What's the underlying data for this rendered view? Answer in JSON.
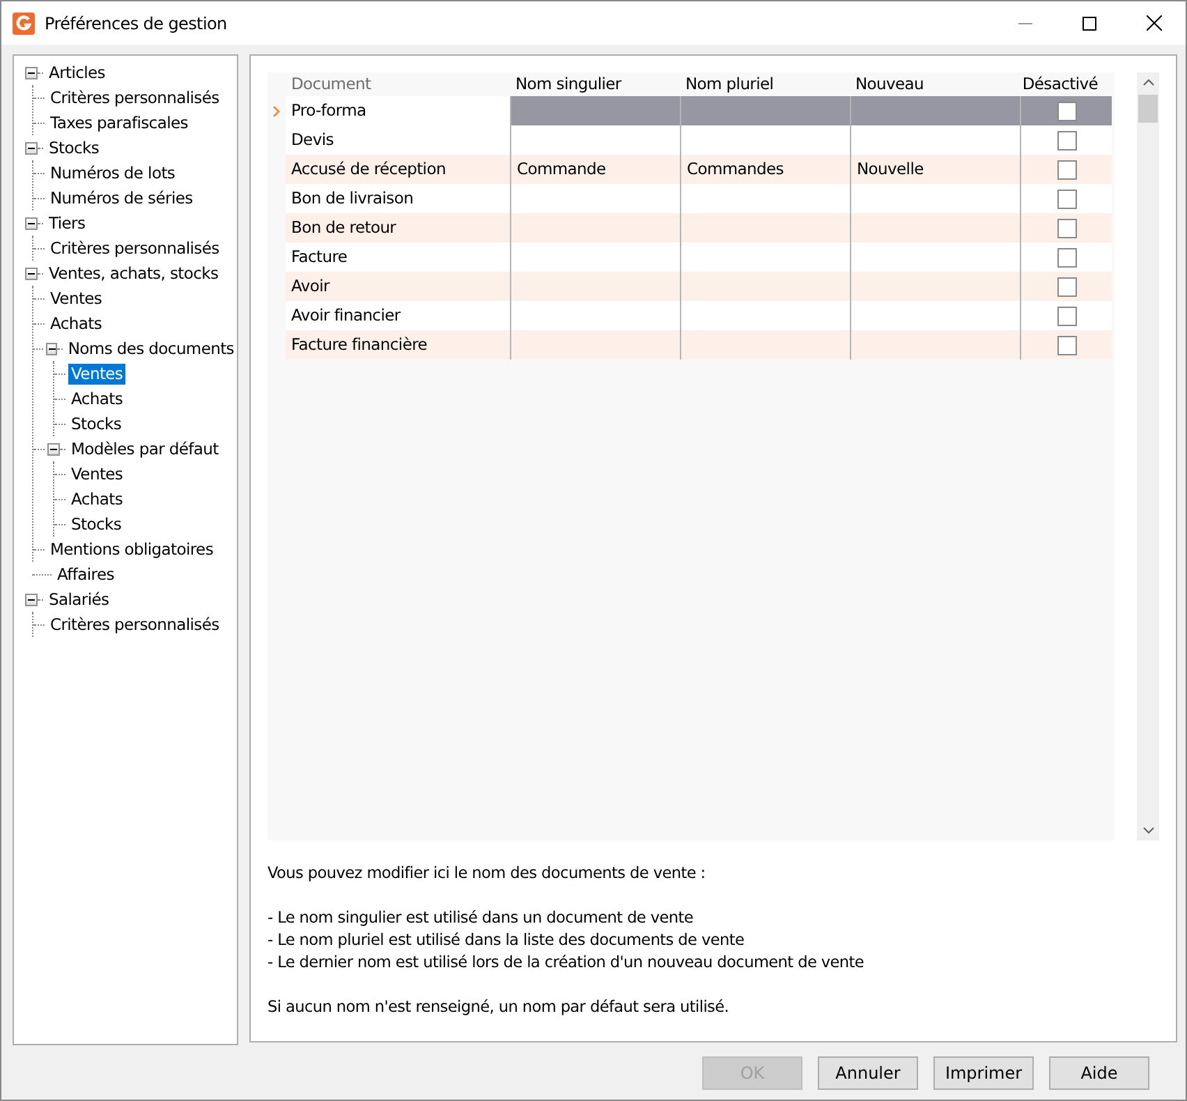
{
  "window": {
    "title": "Préférences de gestion"
  },
  "tree": [
    {
      "label": "Articles",
      "expanded": true,
      "selected": false,
      "children": [
        {
          "label": "Critères personnalisés",
          "selected": false
        },
        {
          "label": "Taxes parafiscales",
          "selected": false
        }
      ]
    },
    {
      "label": "Stocks",
      "expanded": true,
      "selected": false,
      "children": [
        {
          "label": "Numéros de lots",
          "selected": false
        },
        {
          "label": "Numéros de séries",
          "selected": false
        }
      ]
    },
    {
      "label": "Tiers",
      "expanded": true,
      "selected": false,
      "children": [
        {
          "label": "Critères personnalisés",
          "selected": false
        }
      ]
    },
    {
      "label": "Ventes, achats, stocks",
      "expanded": true,
      "selected": false,
      "children": [
        {
          "label": "Ventes",
          "selected": false
        },
        {
          "label": "Achats",
          "selected": false
        },
        {
          "label": "Noms des documents",
          "expanded": true,
          "selected": false,
          "children": [
            {
              "label": "Ventes",
              "selected": true
            },
            {
              "label": "Achats",
              "selected": false
            },
            {
              "label": "Stocks",
              "selected": false
            }
          ]
        },
        {
          "label": "Modèles par défaut",
          "expanded": true,
          "selected": false,
          "children": [
            {
              "label": "Ventes",
              "selected": false
            },
            {
              "label": "Achats",
              "selected": false
            },
            {
              "label": "Stocks",
              "selected": false
            }
          ]
        },
        {
          "label": "Mentions obligatoires",
          "selected": false
        }
      ]
    },
    {
      "label": "Affaires",
      "selected": false
    },
    {
      "label": "Salariés",
      "expanded": true,
      "selected": false,
      "children": [
        {
          "label": "Critères personnalisés",
          "selected": false
        }
      ]
    }
  ],
  "grid": {
    "columns": [
      "Document",
      "Nom singulier",
      "Nom pluriel",
      "Nouveau",
      "Désactivé"
    ],
    "rows": [
      {
        "document": "Pro-forma",
        "nom_singulier": "",
        "nom_pluriel": "",
        "nouveau": "",
        "desactive": false,
        "selected": true
      },
      {
        "document": "Devis",
        "desactive": false,
        "selected": false
      },
      {
        "document": "Accusé de réception",
        "nom_singulier": "Commande",
        "nom_pluriel": "Commandes",
        "nouveau": "Nouvelle",
        "desactive": false,
        "selected": false
      },
      {
        "document": "Bon de livraison",
        "desactive": false,
        "selected": false
      },
      {
        "document": "Bon de retour",
        "desactive": false,
        "selected": false
      },
      {
        "document": "Facture",
        "desactive": false,
        "selected": false
      },
      {
        "document": "Avoir",
        "desactive": false,
        "selected": false
      },
      {
        "document": "Avoir financier",
        "desactive": false,
        "selected": false
      },
      {
        "document": "Facture financière",
        "desactive": false,
        "selected": false
      }
    ]
  },
  "description": [
    [
      "Vous pouvez modifier ici le nom des documents de vente :"
    ],
    [
      "- Le nom singulier est utilisé dans un document de vente",
      "- Le nom pluriel est utilisé dans la liste des documents de vente",
      "- Le dernier nom est utilisé lors de la création d'un nouveau document de vente"
    ],
    [
      "Si aucun nom n'est renseigné, un nom par défaut sera utilisé."
    ]
  ],
  "buttons": [
    {
      "label": "OK",
      "disabled": true
    },
    {
      "label": "Annuler",
      "disabled": false
    },
    {
      "label": "Imprimer",
      "disabled": false
    },
    {
      "label": "Aide",
      "disabled": false
    }
  ]
}
